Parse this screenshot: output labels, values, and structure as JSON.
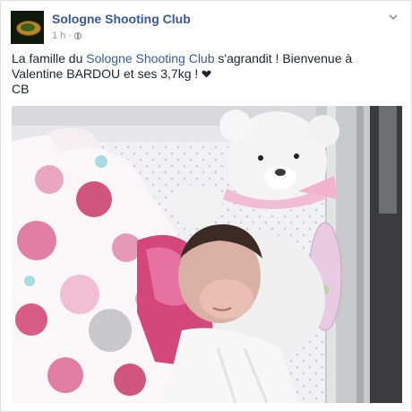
{
  "post": {
    "page_name": "Sologne Shooting Club",
    "timestamp": "1 h",
    "separator": "·",
    "privacy_icon": "globe-icon",
    "options_icon": "chevron-down-icon",
    "text": {
      "before_link": "La famille du ",
      "link": "Sologne Shooting Club",
      "after_link": " s'agrandit ! Bienvenue à Valentine BARDOU et ses 3,7kg ! ",
      "emoji_icon": "heart-icon",
      "signature": "CB"
    }
  },
  "colors": {
    "link": "#365899",
    "meta": "#90949c",
    "text": "#1d2129"
  }
}
